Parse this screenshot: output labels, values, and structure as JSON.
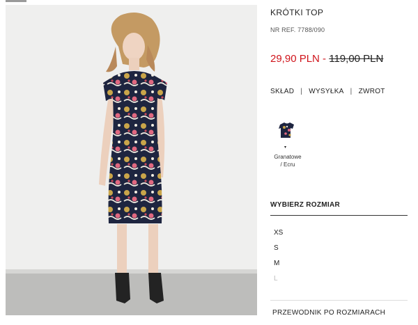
{
  "product": {
    "title": "KRÓTKI TOP",
    "reference": "NR REF. 7788/090",
    "price": {
      "current": "29,90 PLN",
      "separator": " - ",
      "original": "119,00 PLN"
    }
  },
  "info_links": [
    "SKŁAD",
    "WYSYŁKA",
    "ZWROT"
  ],
  "color_option": {
    "name_line1": "Granatowe",
    "name_line2": "/ Ecru"
  },
  "size_section": {
    "heading": "WYBIERZ ROZMIAR",
    "sizes": [
      {
        "label": "XS",
        "available": true
      },
      {
        "label": "S",
        "available": true
      },
      {
        "label": "M",
        "available": true
      },
      {
        "label": "L",
        "available": false
      }
    ]
  },
  "size_guide": "PRZEWODNIK PO ROZMIARACH",
  "colors": {
    "sale_red": "#d0141b",
    "dress_navy": "#1e2540",
    "print_gold": "#c9a54a",
    "print_pink": "#e06880"
  },
  "icons": {
    "swatch_caret": "▾"
  }
}
